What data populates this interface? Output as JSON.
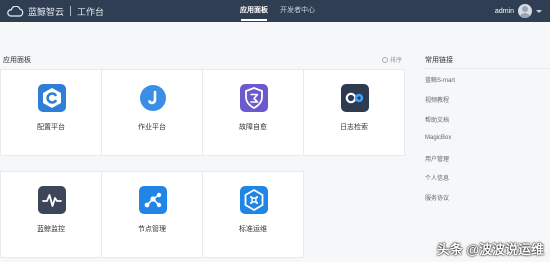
{
  "header": {
    "brand_name": "蓝鲸智云",
    "brand_sub": "工作台",
    "nav": [
      "应用面板",
      "开发者中心"
    ],
    "active_nav": "应用面板",
    "user": "admin",
    "background_color": "#2f3e52"
  },
  "panel": {
    "title": "应用面板",
    "sort_label": "排序",
    "apps": [
      {
        "label": "配置平台",
        "icon": "config-platform-icon",
        "color": "#2f7fd6"
      },
      {
        "label": "作业平台",
        "icon": "job-platform-icon",
        "color": "#3a8ee6"
      },
      {
        "label": "故障自愈",
        "icon": "fault-recovery-icon",
        "color": "#6a5acd"
      },
      {
        "label": "日志检索",
        "icon": "log-search-icon",
        "color": "#2d3a4f"
      },
      {
        "label": "蓝鲸监控",
        "icon": "monitor-icon",
        "color": "#3c4658"
      },
      {
        "label": "节点管理",
        "icon": "node-management-icon",
        "color": "#2185e8"
      },
      {
        "label": "标准运维",
        "icon": "standard-ops-icon",
        "color": "#1f86e6"
      }
    ]
  },
  "links": {
    "title": "常用链接",
    "items": [
      "蓝鲸S-mart",
      "视频教程",
      "帮助文档",
      "MagicBox",
      "用户管理",
      "个人信息",
      "服务协议"
    ]
  },
  "watermark": "头条 @波波说运维"
}
